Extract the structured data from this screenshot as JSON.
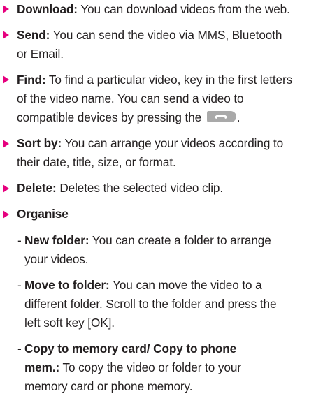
{
  "items": [
    {
      "term": "Download:",
      "lines": [
        "You can download videos from the web."
      ]
    },
    {
      "term": "Send:",
      "lines": [
        "You can send the video via MMS, Bluetooth",
        "or Email."
      ]
    },
    {
      "term": "Find:",
      "lines": [
        "To find a particular video, key in the first letters",
        "of the video name. You can send a video to",
        "compatible devices by pressing the",
        "."
      ]
    },
    {
      "term": "Sort by:",
      "lines": [
        "You can arrange your videos according to",
        "their date, title, size, or format."
      ]
    },
    {
      "term": "Delete:",
      "lines": [
        "Deletes the selected video clip."
      ]
    },
    {
      "term": "Organise",
      "lines": []
    }
  ],
  "subitems": [
    {
      "term": "New folder:",
      "lines": [
        "You can create a folder to arrange",
        "your videos."
      ]
    },
    {
      "term": "Move to folder:",
      "lines": [
        "You can move the video to a",
        "different folder. Scroll to the folder and press the",
        "left soft key [OK]."
      ]
    },
    {
      "term_lines": [
        "Copy to memory card/ Copy to phone",
        "mem.:"
      ],
      "lines": [
        "To copy the video or folder to your",
        "memory card or phone memory."
      ]
    }
  ],
  "colors": {
    "bullet": "#e6007e",
    "text": "#231f20",
    "key_fill": "#a9a9a9"
  },
  "icons": {
    "bullet": "triangle-bullet-icon",
    "send_key": "send-key-icon"
  },
  "dash": "-"
}
